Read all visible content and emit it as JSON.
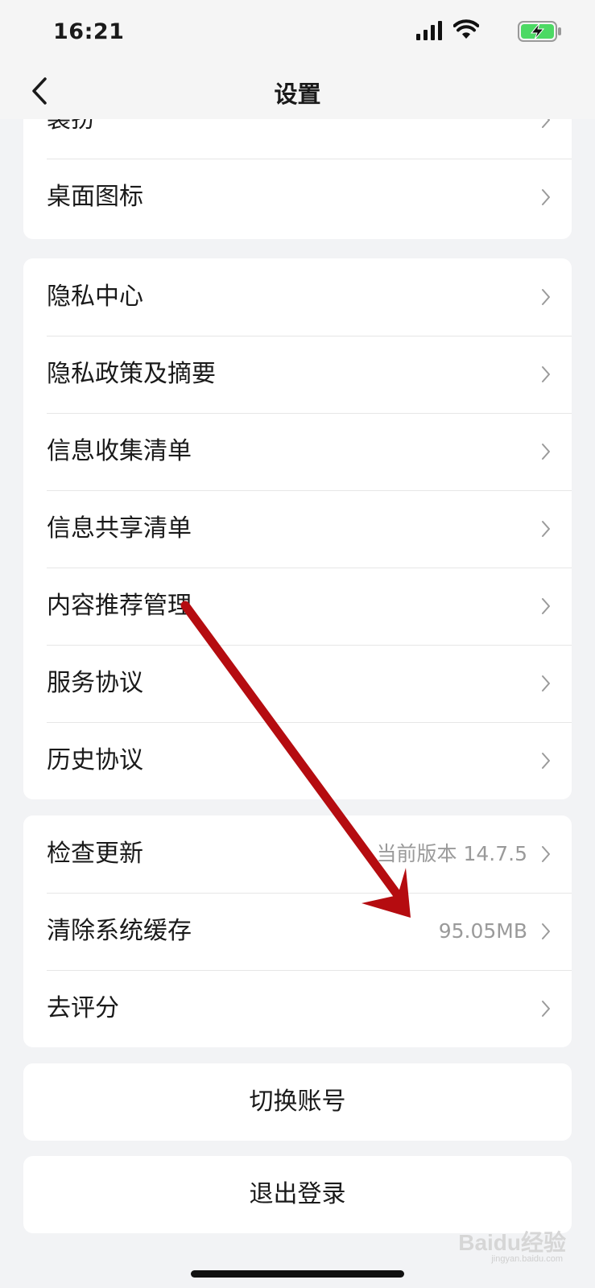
{
  "status_bar": {
    "time": "16:21"
  },
  "nav": {
    "title": "设置"
  },
  "groups": [
    {
      "items": [
        {
          "label": "装扮"
        },
        {
          "label": "桌面图标"
        }
      ]
    },
    {
      "items": [
        {
          "label": "隐私中心"
        },
        {
          "label": "隐私政策及摘要"
        },
        {
          "label": "信息收集清单"
        },
        {
          "label": "信息共享清单"
        },
        {
          "label": "内容推荐管理"
        },
        {
          "label": "服务协议"
        },
        {
          "label": "历史协议"
        }
      ]
    },
    {
      "items": [
        {
          "label": "检查更新",
          "value": "当前版本 14.7.5"
        },
        {
          "label": "清除系统缓存",
          "value": "95.05MB"
        },
        {
          "label": "去评分"
        }
      ]
    }
  ],
  "actions": {
    "switch_account": "切换账号",
    "logout": "退出登录"
  },
  "watermark": {
    "text": "Baidu经验",
    "sub": "jingyan.baidu.com"
  },
  "colors": {
    "annotation_arrow": "#b50c10",
    "battery_green": "#4cd964"
  }
}
